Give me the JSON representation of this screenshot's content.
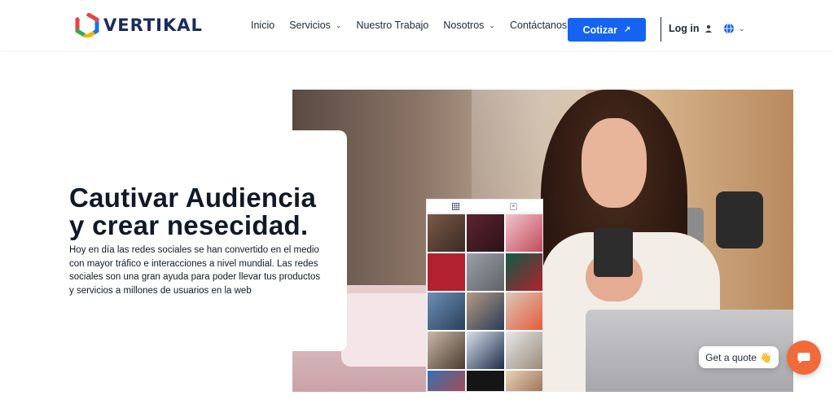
{
  "header": {
    "logo_text": "VERTIKAL",
    "nav": [
      {
        "label": "Inicio",
        "dropdown": false
      },
      {
        "label": "Servicios",
        "dropdown": true
      },
      {
        "label": "Nuestro Trabajo",
        "dropdown": false
      },
      {
        "label": "Nosotros",
        "dropdown": true
      },
      {
        "label": "Contáctanos",
        "dropdown": false
      }
    ],
    "cta_label": "Cotizar",
    "login_label": "Log in"
  },
  "hero": {
    "title": "Cautivar Audiencia y crear nesecidad.",
    "text": "Hoy en día las redes sociales se han convertido en el medio con mayor tráfico e interacciones a nivel mundial. Las redes sociales son una gran ayuda para poder llevar tus productos y servicios a millones de usuarios en la web"
  },
  "widgets": {
    "quote_label": "Get a quote",
    "quote_emoji": "👋"
  },
  "colors": {
    "primary": "#1463f3",
    "chat": "#f06a3a",
    "logo_text": "#1a2b5e"
  },
  "icons": {
    "cta": "arrow-up-right-icon",
    "login": "user-icon",
    "language": "globe-icon",
    "chat": "chat-bubble-icon"
  }
}
